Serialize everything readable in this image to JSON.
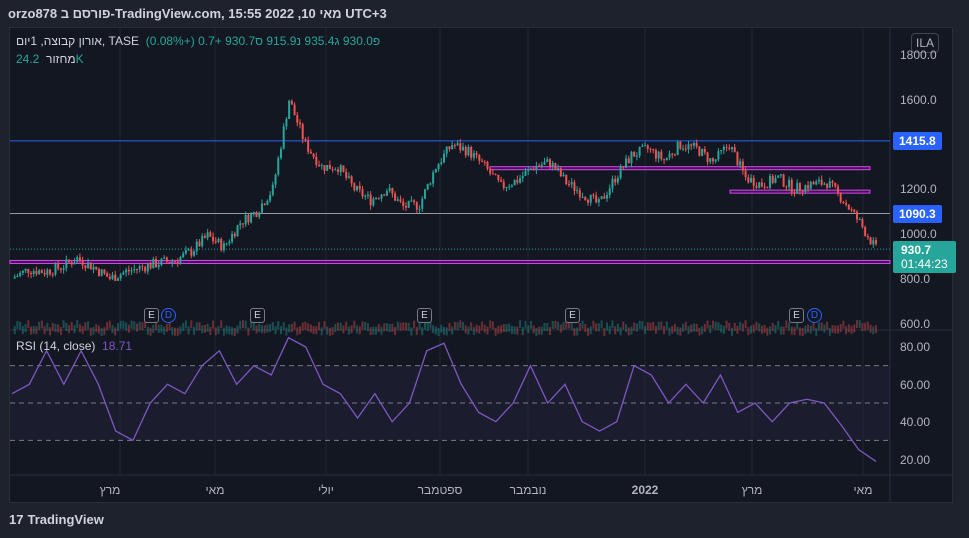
{
  "header": {
    "title": "orzo878 פורסם ב-TradingView.com, מאי 10, 2022 15:55 UTC+3"
  },
  "legend": {
    "symbol": "אורון קבוצה, 1יום, TASE",
    "open_label": "פ",
    "open": "930.0",
    "high_label": "ג",
    "high": "935.4",
    "low_label": "נ",
    "low": "915.9",
    "close_label": "ס",
    "close": "930.7",
    "change": "+0.7 (+0.08%)",
    "volume_label": "מחזור",
    "volume": "24.2K"
  },
  "rsi_legend": {
    "label": "RSI (14, close)",
    "value": "18.71"
  },
  "currency": "ILA",
  "price_tags": {
    "line1": "1415.8",
    "line2": "1090.3",
    "last": "930.7",
    "countdown": "01:44:23"
  },
  "events": {
    "earnings": "E",
    "dividend": "D"
  },
  "branding": "TradingView",
  "colors": {
    "up": "#26a69a",
    "down": "#ef5350",
    "rsi": "#7e57c2",
    "blue_line": "#2962ff",
    "purple": "#e040fb",
    "bg": "#131722"
  },
  "chart_data": [
    {
      "type": "candlestick",
      "title": "אורון קבוצה, 1יום, TASE",
      "ylim": [
        600,
        1800
      ],
      "yticks": [
        "1800.0",
        "1600.0",
        "1200.0",
        "1000.0",
        "800.0",
        "600.0"
      ],
      "xticks": [
        "מרץ",
        "מאי",
        "יולי",
        "ספטמבר",
        "נובמבר",
        "2022",
        "מרץ",
        "מאי"
      ],
      "close_path": [
        800,
        840,
        830,
        850,
        890,
        850,
        800,
        830,
        850,
        870,
        880,
        920,
        990,
        940,
        1050,
        1100,
        1200,
        1600,
        1400,
        1300,
        1300,
        1200,
        1150,
        1200,
        1120,
        1130,
        1300,
        1400,
        1370,
        1300,
        1210,
        1240,
        1300,
        1320,
        1230,
        1180,
        1130,
        1250,
        1350,
        1380,
        1330,
        1400,
        1380,
        1320,
        1400,
        1250,
        1220,
        1250,
        1200,
        1220,
        1230,
        1150,
        1050,
        930.7
      ],
      "horizontal_lines": [
        1415.8,
        1090.3,
        930.7
      ],
      "zones": [
        {
          "from": 1290,
          "to": 1300
        },
        {
          "from": 1185,
          "to": 1195
        },
        {
          "from": 870,
          "to": 880
        }
      ]
    },
    {
      "type": "line",
      "title": "RSI (14, close)",
      "ylim": [
        10,
        90
      ],
      "yticks": [
        "80.00",
        "60.00",
        "40.00",
        "20.00"
      ],
      "levels": [
        70,
        50,
        30
      ],
      "values": [
        55,
        60,
        78,
        60,
        78,
        60,
        35,
        30,
        50,
        60,
        55,
        70,
        78,
        60,
        70,
        65,
        85,
        80,
        60,
        55,
        42,
        55,
        40,
        50,
        78,
        82,
        60,
        45,
        40,
        50,
        70,
        50,
        60,
        40,
        35,
        40,
        70,
        65,
        50,
        60,
        50,
        65,
        45,
        50,
        40,
        50,
        52,
        50,
        38,
        25,
        18.71
      ]
    }
  ]
}
